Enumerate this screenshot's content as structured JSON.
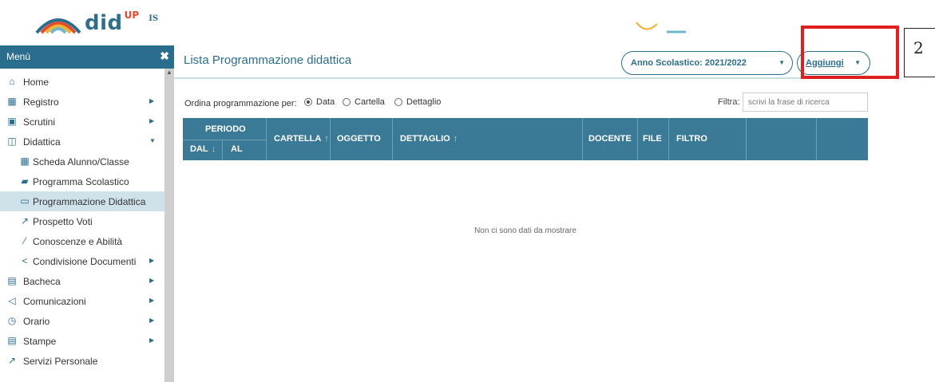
{
  "brand": {
    "name": "did",
    "sup": "UP",
    "suffix": "IS",
    "colors": {
      "primary": "#2b6d8d",
      "accent": "#e44b2c"
    }
  },
  "sidebar": {
    "title": "Menù",
    "close_icon": "close-icon",
    "items": [
      {
        "label": "Home",
        "icon": "home-icon",
        "submenu": false
      },
      {
        "label": "Registro",
        "icon": "calendar-icon",
        "submenu": true
      },
      {
        "label": "Scrutini",
        "icon": "scrutini-icon",
        "submenu": true
      },
      {
        "label": "Didattica",
        "icon": "book-open-icon",
        "submenu": true,
        "expanded": true
      },
      {
        "label": "Scheda Alunno/Classe",
        "icon": "table-icon",
        "submenu": false
      },
      {
        "label": "Programma Scolastico",
        "icon": "book-icon",
        "submenu": false
      },
      {
        "label": "Programmazione Didattica",
        "icon": "keyboard-icon",
        "submenu": false,
        "active": true
      },
      {
        "label": "Prospetto Voti",
        "icon": "chart-icon",
        "submenu": false
      },
      {
        "label": "Conoscenze e Abilità",
        "icon": "magic-wand-icon",
        "submenu": false
      },
      {
        "label": "Condivisione Documenti",
        "icon": "share-icon",
        "submenu": true
      },
      {
        "label": "Bacheca",
        "icon": "bulletin-icon",
        "submenu": true
      },
      {
        "label": "Comunicazioni",
        "icon": "megaphone-icon",
        "submenu": true
      },
      {
        "label": "Orario",
        "icon": "clock-icon",
        "submenu": true
      },
      {
        "label": "Stampe",
        "icon": "printer-icon",
        "submenu": true
      },
      {
        "label": "Servizi Personale",
        "icon": "external-icon",
        "submenu": false
      }
    ]
  },
  "main": {
    "title": "Lista Programmazione didattica",
    "year_select": "Anno Scolastico: 2021/2022",
    "add_button": "Aggiungi",
    "annotation_number": "2",
    "order_label": "Ordina programmazione per:",
    "order_options": [
      {
        "label": "Data",
        "selected": true
      },
      {
        "label": "Cartella",
        "selected": false
      },
      {
        "label": "Dettaglio",
        "selected": false
      }
    ],
    "filter_label": "Filtra:",
    "filter_placeholder": "scrivi la frase di ricerca",
    "table": {
      "periodo": "PERIODO",
      "dal": "DAL",
      "al": "AL",
      "columns": [
        "CARTELLA",
        "OGGETTO",
        "DETTAGLIO",
        "DOCENTE",
        "FILE",
        "FILTRO"
      ],
      "empty_message": "Non ci sono dati da mostrare"
    }
  }
}
